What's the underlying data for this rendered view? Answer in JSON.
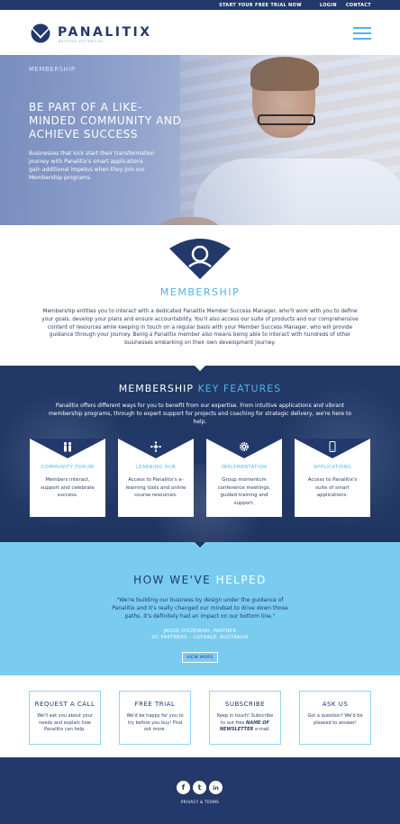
{
  "topbar": {
    "trial": "Start your free trial now",
    "login": "Login",
    "contact": "Contact"
  },
  "header": {
    "logo_text": "PANALITIX",
    "logo_tagline": "Beyond Potential"
  },
  "hero": {
    "label": "Membership",
    "title": "Be part of a like-minded community and achieve success",
    "text": "Businesses that kick start their transformation journey with Panalitix's smart applications gain additional impetus when they join our Membership programs."
  },
  "membership": {
    "title": "MEMBERSHIP",
    "text": "Membership entitles you to interact with a dedicated Panalitix Member Success Manager, who'll work with you to define your goals, develop your plans and ensure accountability. You'll also access our suite of products and our comprehensive content of resources while keeping in touch on a regular basis with your Member Success Manager, who will provide guidance through your journey. Being a Panalitix member also means being able to interact with hundreds of other businesses embarking on their own development journey."
  },
  "features": {
    "title_a": "MEMBERSHIP ",
    "title_b": "KEY FEATURES",
    "text": "Panalitix offers different ways for you to benefit from our expertise. From intuitive applications and vibrant membership programs, through to expert support for projects and coaching for strategic delivery, we're here to help.",
    "cards": [
      {
        "title": "Community Forum",
        "text": "Members interact, support and celebrate success.",
        "icon": "people-icon"
      },
      {
        "title": "Learning Hub",
        "text": "Access to Panalitix's e-learning tools and online course resources.",
        "icon": "network-icon"
      },
      {
        "title": "Implementation",
        "text": "Group momentum conference meetings, guided training and support.",
        "icon": "gear-icon"
      },
      {
        "title": "Applications",
        "text": "Access to Panalitix's suite of smart applications.",
        "icon": "mobile-icon"
      }
    ]
  },
  "helped": {
    "title_a": "HOW WE'VE ",
    "title_b": "HELPED",
    "quote": "\"We're building our business by design under the guidance of Panalitix and it's really changed our mindset to drive down those paths. It's definitely had an impact on our bottom line.\"",
    "author": "Jason Oiszewski, Partner",
    "company": "OC Partners – Lilydale, Australia",
    "button": "View More"
  },
  "cta": [
    {
      "heading": "Request a Call",
      "text": "We'll ask you about your needs and explain how Panalitix can help."
    },
    {
      "heading": "Free Trial",
      "text": "We'd be happy for you to try before you buy! Find out more."
    },
    {
      "heading": "Subscribe",
      "text_a": "Keep in touch! Subscribe to our free ",
      "text_b": "NAME OF NEWSLETTER",
      "text_c": " e-mail."
    },
    {
      "heading": "Ask Us",
      "text": "Got a question? We'd be pleased to answer!"
    }
  ],
  "footer": {
    "social": [
      {
        "label": "f",
        "icon": "facebook-icon"
      },
      {
        "label": "t",
        "icon": "twitter-icon"
      },
      {
        "label": "in",
        "icon": "linkedin-icon"
      }
    ],
    "policy": "Privacy & Terms"
  },
  "colors": {
    "navy": "#23396b",
    "accent": "#4fb3e8",
    "sky": "#79ccf0"
  }
}
